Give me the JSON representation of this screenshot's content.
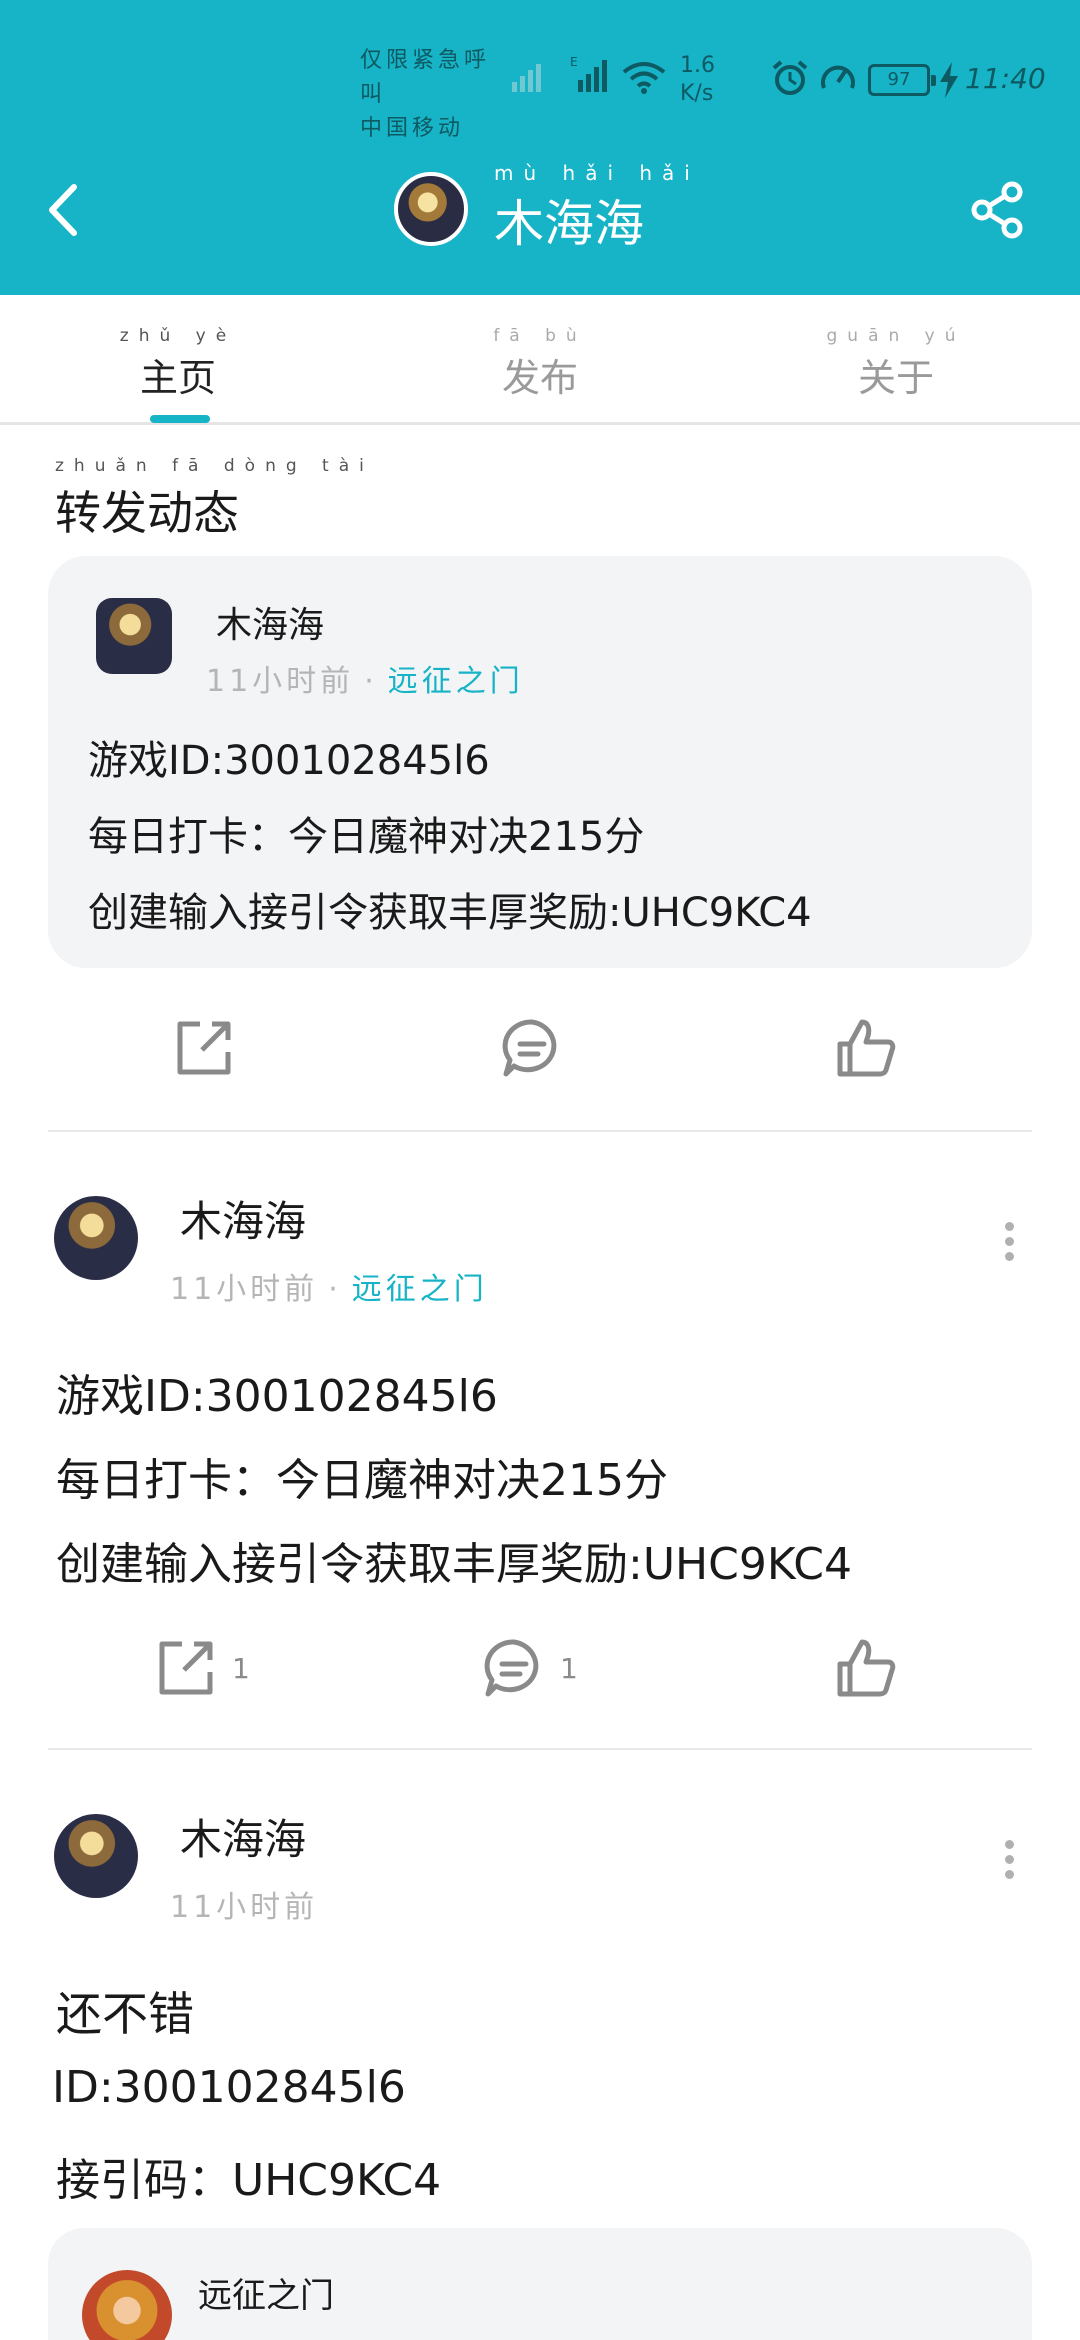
{
  "status_bar": {
    "carrier_line1": "仅限紧急呼叫",
    "carrier_line2": "中国移动",
    "speed_value": "1.6",
    "speed_unit": "K/s",
    "battery": "97",
    "time": "11:40"
  },
  "header": {
    "title": "木海海",
    "title_ruby": "mù hǎi hǎi",
    "accent_color": "#17b3c6"
  },
  "tabs": [
    {
      "label": "主页",
      "ruby": "zhǔ yè"
    },
    {
      "label": "发布",
      "ruby": "fā bù"
    },
    {
      "label": "关于",
      "ruby": "guān yú"
    }
  ],
  "section_title": "转发动态",
  "section_title_ruby": "zhuǎn fā dòng tài",
  "forwarded_card": {
    "author": "木海海",
    "time": "11小时前",
    "game": "远征之门",
    "line1": "游戏ID:300102845l6",
    "line2": "每日打卡：今日魔神对决215分",
    "line3": "创建输入接引令获取丰厚奖励:UHC9KC4"
  },
  "post1": {
    "author": "木海海",
    "time": "11小时前",
    "game": "远征之门",
    "line1": "游戏ID:300102845l6",
    "line2": "每日打卡：今日魔神对决215分",
    "line3": "创建输入接引令获取丰厚奖励:UHC9KC4",
    "share_count": "1",
    "comment_count": "1"
  },
  "post2": {
    "author": "木海海",
    "time": "11小时前",
    "line1": "还不错",
    "line2": "ID:300102845l6",
    "line3": "接引码：UHC9KC4",
    "attachment_title": "远征之门"
  }
}
